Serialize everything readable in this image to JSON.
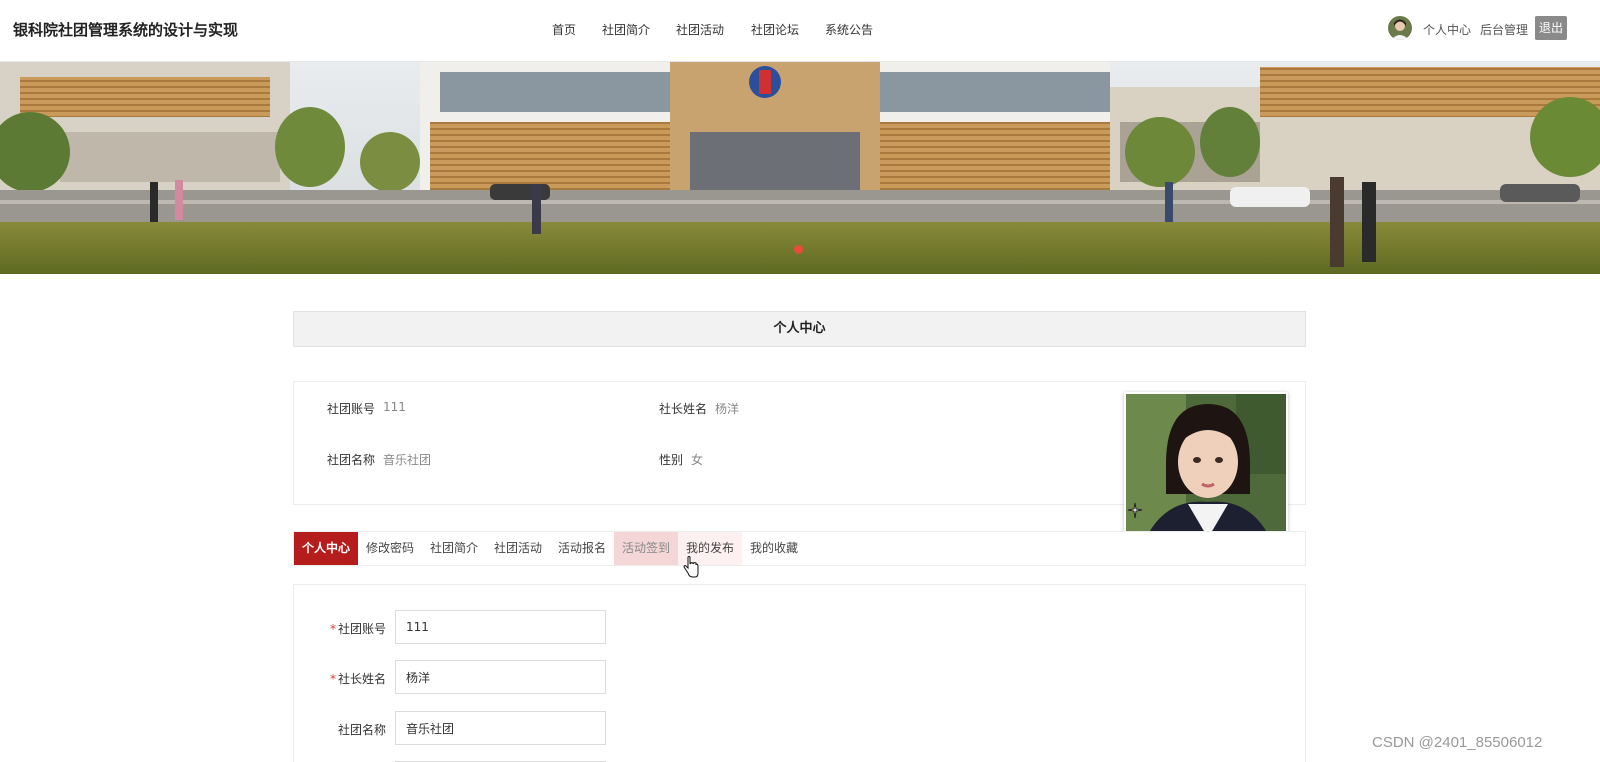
{
  "header": {
    "brand": "银科院社团管理系统的设计与实现",
    "nav": [
      "首页",
      "社团简介",
      "社团活动",
      "社团论坛",
      "系统公告"
    ],
    "user_center": "个人中心",
    "admin": "后台管理",
    "logout": "退出"
  },
  "banner": {
    "active_dot_color": "#e74c3c"
  },
  "page": {
    "title": "个人中心"
  },
  "info": {
    "account_label": "社团账号",
    "account_value": "111",
    "leader_label": "社长姓名",
    "leader_value": "杨洋",
    "club_label": "社团名称",
    "club_value": "音乐社团",
    "gender_label": "性别",
    "gender_value": "女"
  },
  "tabs": [
    "个人中心",
    "修改密码",
    "社团简介",
    "社团活动",
    "活动报名",
    "活动签到",
    "我的发布",
    "我的收藏"
  ],
  "form": {
    "account_label": "社团账号",
    "account_value": "111",
    "leader_label": "社长姓名",
    "leader_value": "杨洋",
    "club_label": "社团名称",
    "club_value": "音乐社团",
    "required_mark": "*"
  },
  "watermark": "CSDN @2401_85506012",
  "colors": {
    "accent": "#b51c1c",
    "tab_hover": "#f5d6d6",
    "logout_bg": "#8a8a8a"
  }
}
